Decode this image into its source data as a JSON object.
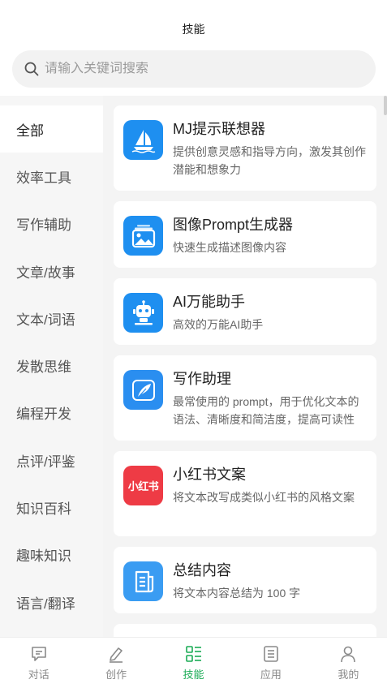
{
  "header": {
    "title": "技能"
  },
  "search": {
    "placeholder": "请输入关键词搜索",
    "icon": "search-icon"
  },
  "sidebar": {
    "items": [
      {
        "label": "全部",
        "active": true
      },
      {
        "label": "效率工具"
      },
      {
        "label": "写作辅助"
      },
      {
        "label": "文章/故事"
      },
      {
        "label": "文本/词语"
      },
      {
        "label": "发散思维"
      },
      {
        "label": "编程开发"
      },
      {
        "label": "点评/评鉴"
      },
      {
        "label": "知识百科"
      },
      {
        "label": "趣味知识"
      },
      {
        "label": "语言/翻译"
      }
    ]
  },
  "skills": [
    {
      "name": "MJ提示联想器",
      "desc": "提供创意灵感和指导方向，激发其创作潜能和想象力",
      "icon": "sailboat-icon",
      "color": "#1e8ff0"
    },
    {
      "name": "图像Prompt生成器",
      "desc": "快速生成描述图像内容",
      "icon": "picture-icon",
      "color": "#1e8ff0"
    },
    {
      "name": "AI万能助手",
      "desc": "高效的万能AI助手",
      "icon": "robot-icon",
      "color": "#1e8ff0"
    },
    {
      "name": "写作助理",
      "desc": "最常使用的 prompt，用于优化文本的语法、清晰度和简洁度，提高可读性",
      "icon": "feather-icon",
      "color": "#2a8ef0"
    },
    {
      "name": "小红书文案",
      "desc": "将文本改写成类似小红书的风格文案",
      "icon": "xiaohongshu-icon",
      "logo_text": "小红书",
      "color": "#ee3b45"
    },
    {
      "name": "总结内容",
      "desc": "将文本内容总结为 100 字",
      "icon": "document-icon",
      "color": "#3a9cf2"
    }
  ],
  "tabbar": {
    "items": [
      {
        "label": "对话",
        "icon": "chat-icon"
      },
      {
        "label": "创作",
        "icon": "pen-icon"
      },
      {
        "label": "技能",
        "icon": "skills-grid-icon",
        "active": true
      },
      {
        "label": "应用",
        "icon": "list-icon"
      },
      {
        "label": "我的",
        "icon": "user-icon"
      }
    ]
  },
  "colors": {
    "accent": "#1aab55",
    "sidebar_bg": "#f6f6f6",
    "content_bg": "#f4f4f4"
  }
}
